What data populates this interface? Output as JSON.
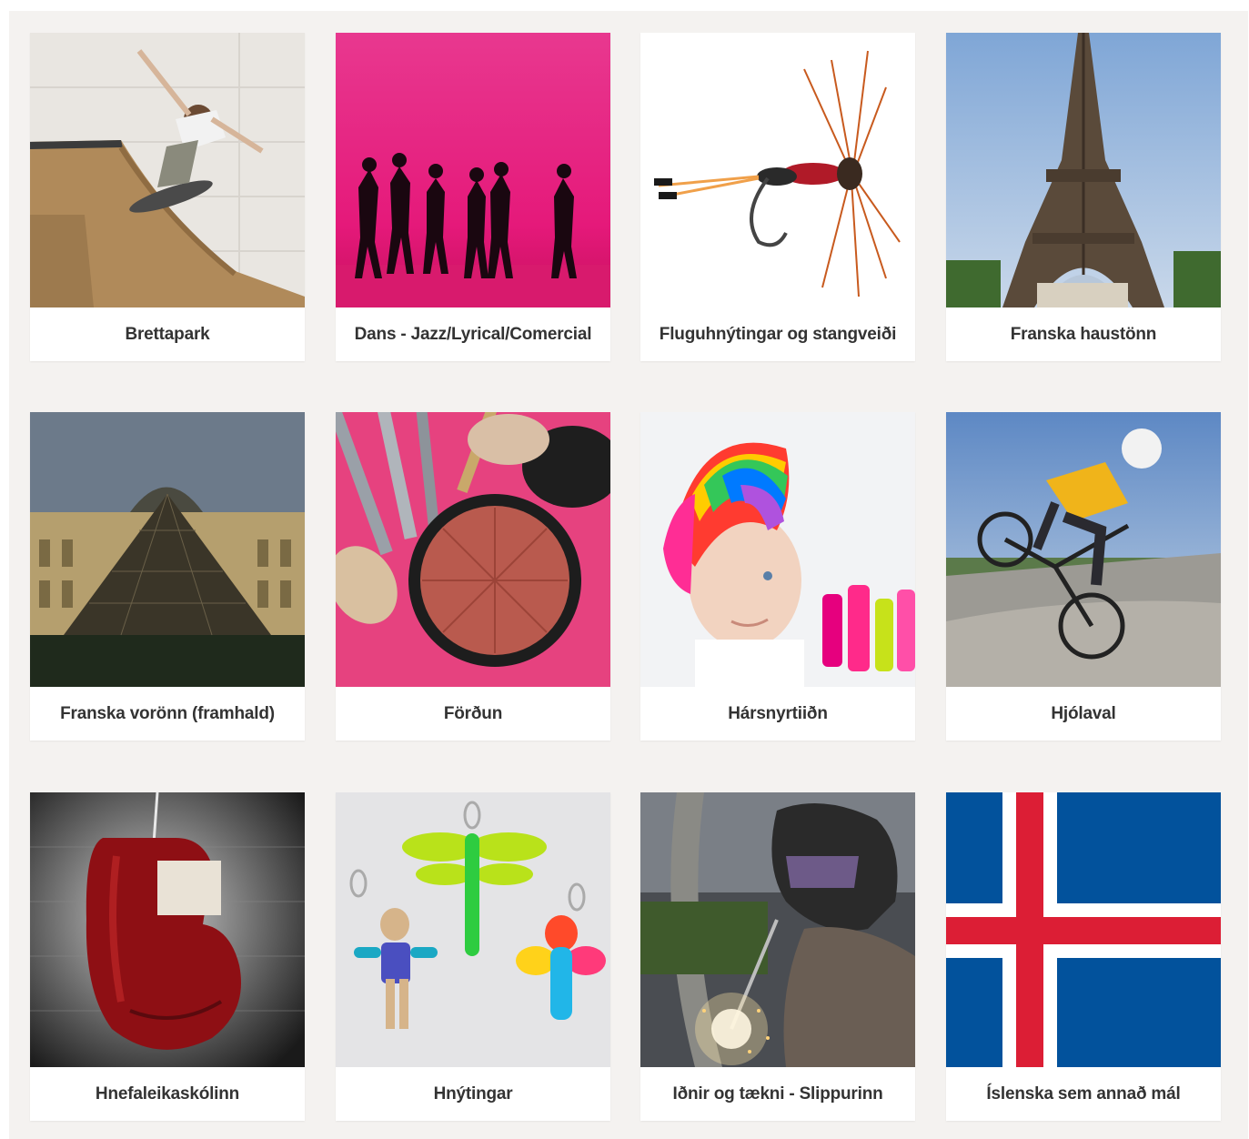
{
  "courses": [
    {
      "title": "Brettapark",
      "image": "skateboard-ramp-photo"
    },
    {
      "title": "Dans - Jazz/Lyrical/Comercial",
      "image": "dancers-silhouette-photo"
    },
    {
      "title": "Fluguhnýtingar og stangveiði",
      "image": "fishing-fly-photo"
    },
    {
      "title": "Franska haustönn",
      "image": "eiffel-tower-photo"
    },
    {
      "title": "Franska vorönn (framhald)",
      "image": "louvre-pyramid-photo"
    },
    {
      "title": "Förðun",
      "image": "makeup-brushes-photo"
    },
    {
      "title": "Hársnyrtiiðn",
      "image": "rainbow-hair-photo"
    },
    {
      "title": "Hjólaval",
      "image": "bmx-rider-photo"
    },
    {
      "title": "Hnefaleikaskólinn",
      "image": "boxing-glove-photo"
    },
    {
      "title": "Hnýtingar",
      "image": "paracord-keychains-photo"
    },
    {
      "title": "Iðnir og tækni - Slippurinn",
      "image": "welder-photo"
    },
    {
      "title": "Íslenska sem annað mál",
      "image": "iceland-flag"
    }
  ],
  "colors": {
    "panel_background": "#f4f2f0",
    "card_background": "#ffffff",
    "label_text": "#333333",
    "flag_blue": "#02529C",
    "flag_red": "#DC1E35"
  }
}
